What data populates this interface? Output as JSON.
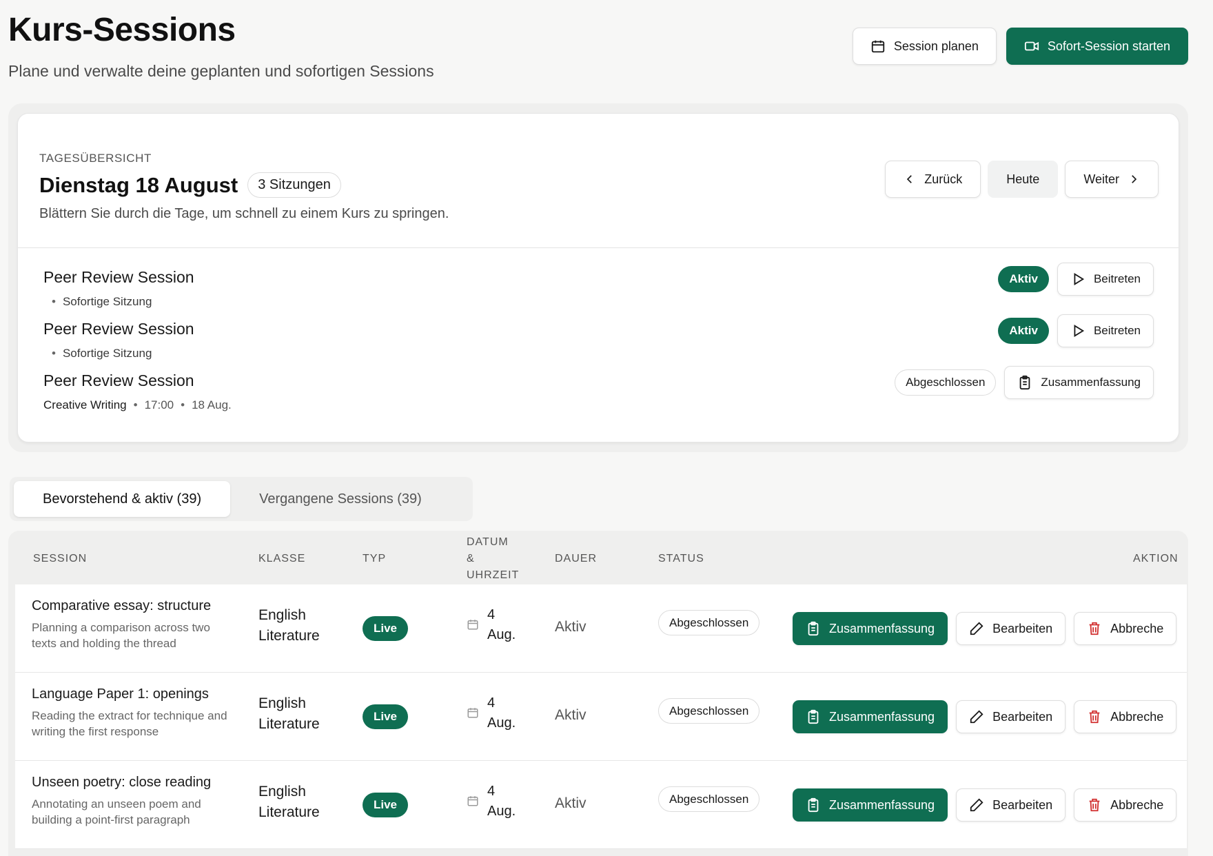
{
  "header": {
    "title": "Kurs-Sessions",
    "subtitle": "Plane und verwalte deine geplanten und sofortigen Sessions",
    "plan_button": "Session planen",
    "start_button": "Sofort-Session starten"
  },
  "day_overview": {
    "overline": "TAGESÜBERSICHT",
    "title": "Dienstag 18 August",
    "count": "3 Sitzungen",
    "description": "Blättern Sie durch die Tage, um schnell zu einem Kurs zu springen.",
    "nav": {
      "prev": "Zurück",
      "today": "Heute",
      "next": "Weiter"
    },
    "sessions": [
      {
        "title": "Peer Review Session",
        "meta": [
          "Sofortige Sitzung"
        ],
        "status": "Aktiv",
        "action": "Beitreten"
      },
      {
        "title": "Peer Review Session",
        "meta": [
          "Sofortige Sitzung"
        ],
        "status": "Aktiv",
        "action": "Beitreten"
      },
      {
        "title": "Peer Review Session",
        "meta": [
          "Creative Writing",
          "17:00",
          "18 Aug."
        ],
        "status": "Abgeschlossen",
        "action": "Zusammenfassung"
      }
    ]
  },
  "tabs": [
    {
      "label": "Bevorstehend & aktiv (39)"
    },
    {
      "label": "Vergangene Sessions (39)"
    }
  ],
  "table": {
    "headers": {
      "session": "SESSION",
      "klasse": "KLASSE",
      "typ": "TYP",
      "datum": [
        "DATUM",
        "&",
        "UHRZEIT"
      ],
      "dauer": "DAUER",
      "status": "STATUS",
      "aktion": "AKTION"
    },
    "actions": {
      "summary": "Zusammenfassung",
      "edit": "Bearbeiten",
      "cancel": "Abbreche"
    },
    "rows": [
      {
        "title": "Comparative essay: structure",
        "desc": "Planning a comparison across two texts and holding the thread",
        "klasse": [
          "English",
          "Literature"
        ],
        "typ": "Live",
        "date": [
          "4",
          "Aug."
        ],
        "dauer": "Aktiv",
        "status": "Abgeschlossen"
      },
      {
        "title": "Language Paper 1: openings",
        "desc": "Reading the extract for technique and writing the first response",
        "klasse": [
          "English",
          "Literature"
        ],
        "typ": "Live",
        "date": [
          "4",
          "Aug."
        ],
        "dauer": "Aktiv",
        "status": "Abgeschlossen"
      },
      {
        "title": "Unseen poetry: close reading",
        "desc": "Annotating an unseen poem and building a point-first paragraph",
        "klasse": [
          "English",
          "Literature"
        ],
        "typ": "Live",
        "date": [
          "4",
          "Aug."
        ],
        "dauer": "Aktiv",
        "status": "Abgeschlossen"
      }
    ]
  },
  "colors": {
    "brand": "#0f6e52",
    "danger": "#d12e2e"
  }
}
